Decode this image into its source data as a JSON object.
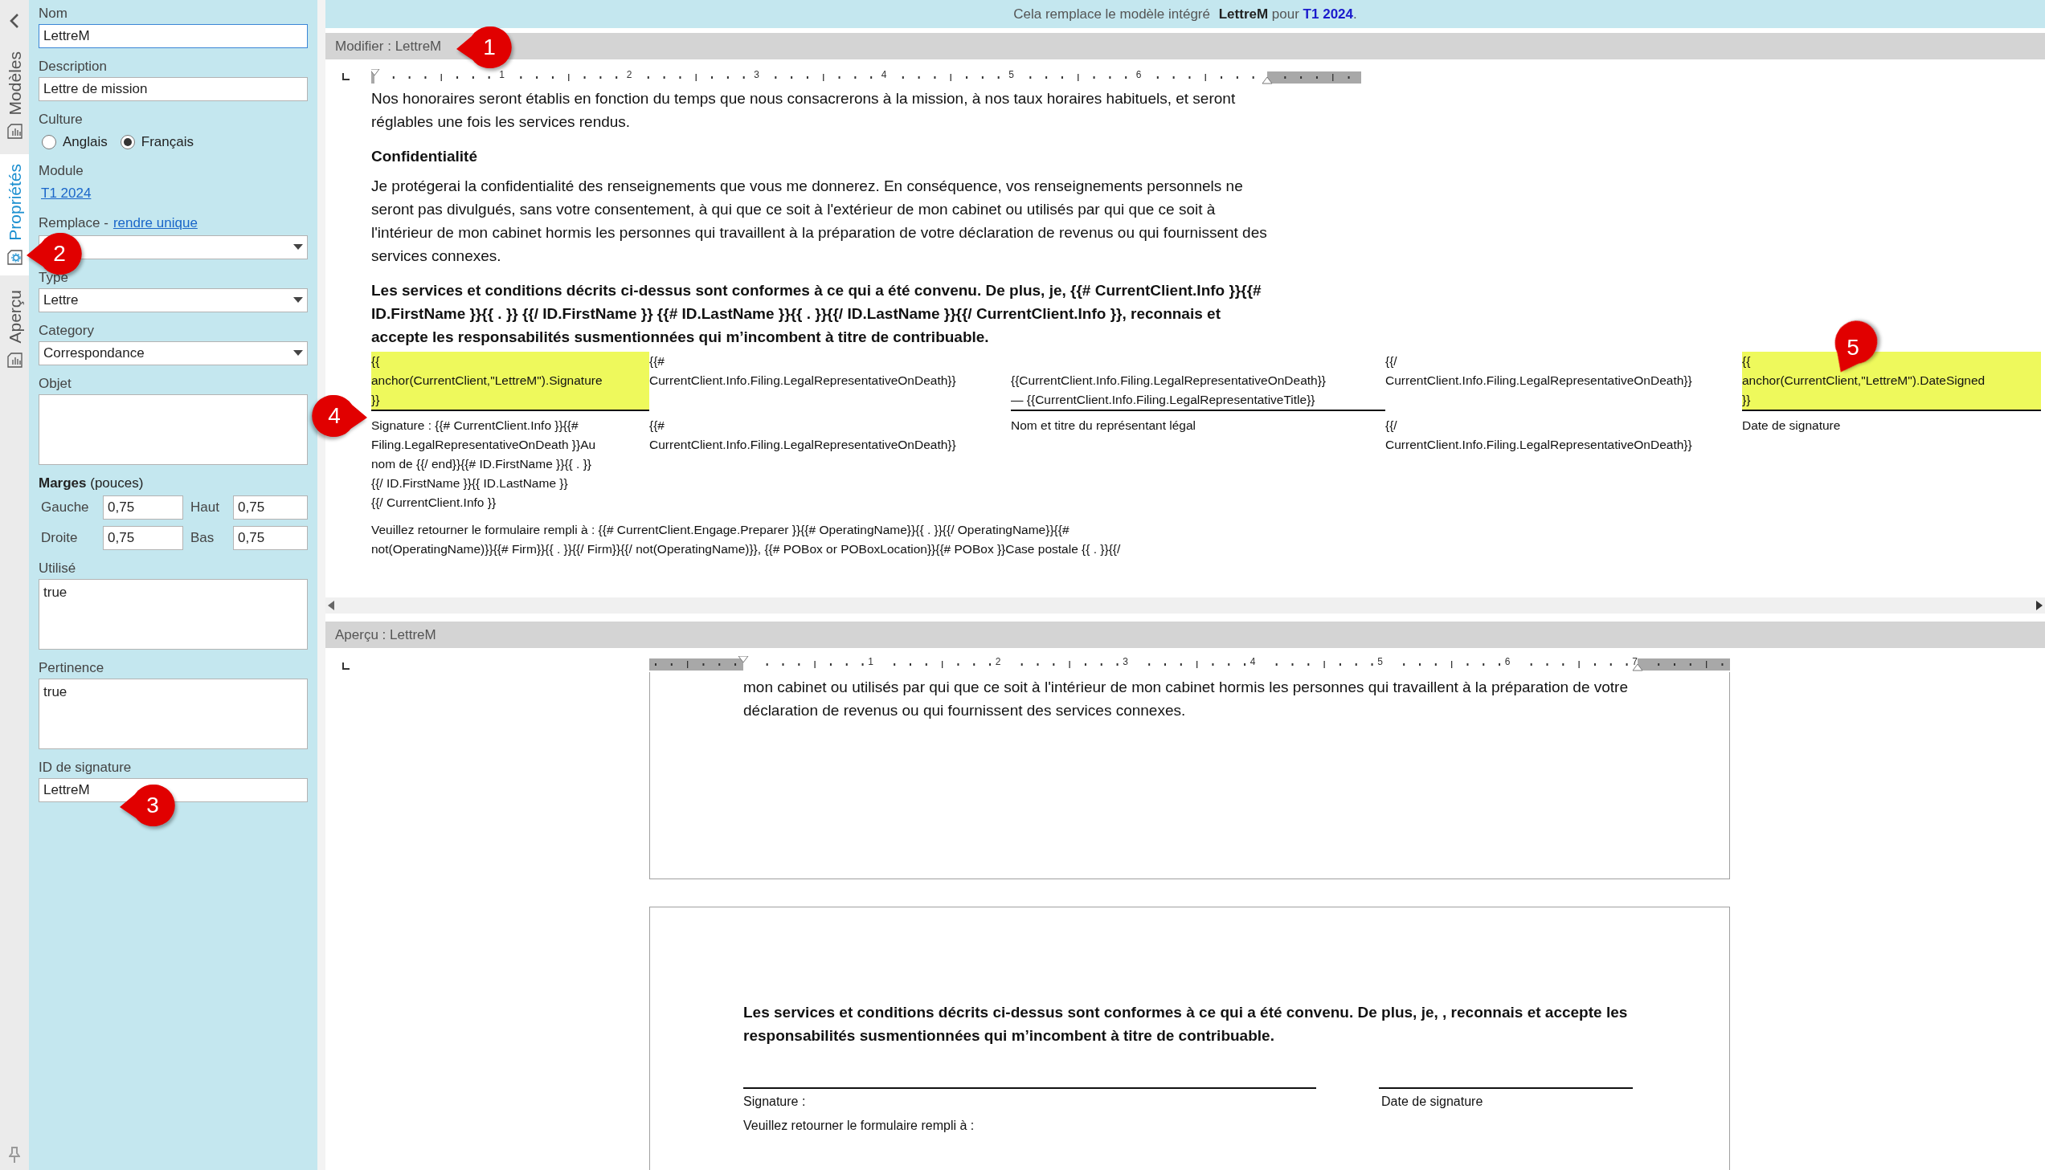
{
  "side_tabs": [
    {
      "label": "Modèles",
      "selected": false
    },
    {
      "label": "Propriétés",
      "selected": true
    },
    {
      "label": "Aperçu",
      "selected": false
    }
  ],
  "properties": {
    "fields": [
      {
        "kind": "text",
        "label": "Nom",
        "value": "LettreM",
        "focused": true
      },
      {
        "kind": "text",
        "label": "Description",
        "value": "Lettre de mission",
        "focused": false
      },
      {
        "kind": "radio",
        "label": "Culture",
        "options": [
          {
            "label": "Anglais",
            "selected": false
          },
          {
            "label": "Français",
            "selected": true
          }
        ]
      },
      {
        "kind": "link",
        "label": "Module",
        "link": "T1 2024"
      },
      {
        "kind": "dropdown",
        "label": "Remplace -",
        "link": "rendre unique"
      },
      {
        "kind": "dropdown",
        "label": "Type",
        "value": "Lettre"
      },
      {
        "kind": "dropdown",
        "label": "Category",
        "value": "Correspondance"
      },
      {
        "kind": "textarea",
        "label": "Objet"
      },
      {
        "kind": "margins",
        "label": "**Marges** (pouces)",
        "items": [
          {
            "label": "Gauche",
            "value": "0,75"
          },
          {
            "label": "Haut",
            "value": "0,75"
          },
          {
            "label": "Droite",
            "value": "0,75"
          },
          {
            "label": "Bas",
            "value": "0,75"
          }
        ]
      },
      {
        "kind": "textarea",
        "label": "Utilisé",
        "value": "true"
      },
      {
        "kind": "textarea",
        "label": "Pertinence",
        "value": "true"
      },
      {
        "kind": "text",
        "label": "ID de signature",
        "value": "LettreM",
        "focused": false
      }
    ]
  },
  "banner": {
    "before": "Cela remplace le modèle intégré",
    "template": "LettreM",
    "middle": "pour",
    "module": "T1 2024",
    "after": "."
  },
  "editor": {
    "title": "Modifier : LettreM",
    "ruler": [
      "1",
      "2",
      "3",
      "4",
      "5",
      "6"
    ],
    "paragraphs": [
      {
        "kind": "normal",
        "text": "Nos honoraires seront établis en fonction du temps que nous consacrerons à la mission, à nos taux horaires habituels, et seront réglables une fois les services rendus."
      },
      {
        "kind": "heading",
        "text": "Confidentialité"
      },
      {
        "kind": "normal",
        "text": "Je protégerai la confidentialité des renseignements que vous me donnerez. En conséquence, vos renseignements personnels ne seront pas divulgués, sans votre consentement, à qui que ce soit à l'extérieur de mon cabinet ou utilisés par qui que ce soit à l'intérieur de mon cabinet hormis les personnes qui travaillent à la préparation de votre déclaration de revenus ou qui fournissent des services connexes."
      },
      {
        "kind": "bold",
        "text": "Les services et conditions décrits ci-dessus sont conformes à ce qui a été convenu. De plus, je, {{# CurrentClient.Info }}{{# ID.FirstName }}{{ . }} {{/ ID.FirstName }} {{# ID.LastName }}{{ . }}{{/ ID.LastName }}{{/ CurrentClient.Info }}, reconnais et accepte les responsabilités susmentionnées qui m’incombent à titre de contribuable."
      }
    ],
    "signature_table": [
      [
        {
          "lines": [
            "{{",
            "anchor(CurrentClient,\"LettreM\").Signature",
            "}}"
          ],
          "highlighted": true,
          "underlined": true
        },
        {
          "lines": [
            "{{#",
            "CurrentClient.Info.Filing.LegalRepresentativeOnDeath}}"
          ],
          "highlighted": false,
          "underlined": false
        },
        {
          "lines": [
            "{{CurrentClient.Info.Filing.LegalRepresentativeOnDeath}}",
            "— {{CurrentClient.Info.Filing.LegalRepresentativeTitle}}"
          ],
          "highlighted": false,
          "underlined": true
        },
        {
          "lines": [
            "{{/",
            "CurrentClient.Info.Filing.LegalRepresentativeOnDeath}}"
          ],
          "highlighted": false,
          "underlined": false
        },
        {
          "lines": [
            "{{",
            "anchor(CurrentClient,\"LettreM\").DateSigned",
            "}}"
          ],
          "highlighted": true,
          "underlined": true
        }
      ],
      [
        {
          "lines": [
            "Signature : {{# CurrentClient.Info }}{{#",
            "Filing.LegalRepresentativeOnDeath }}Au",
            "nom de {{/ end}}{{# ID.FirstName }}{{ . }}",
            "{{/ ID.FirstName }}{{ ID.LastName }}",
            "{{/ CurrentClient.Info }}"
          ],
          "highlighted": false,
          "underlined": false
        },
        {
          "lines": [
            "{{#",
            "CurrentClient.Info.Filing.LegalRepresentativeOnDeath}}"
          ],
          "highlighted": false,
          "underlined": false
        },
        {
          "lines": [
            "Nom et titre du représentant légal"
          ],
          "highlighted": false,
          "underlined": false
        },
        {
          "lines": [
            "{{/",
            "CurrentClient.Info.Filing.LegalRepresentativeOnDeath}}"
          ],
          "highlighted": false,
          "underlined": false
        },
        {
          "lines": [
            "Date de signature"
          ],
          "highlighted": false,
          "underlined": false
        }
      ]
    ],
    "closing_lines": [
      "Veuillez retourner le formulaire rempli à : {{# CurrentClient.Engage.Preparer }}{{# OperatingName}}{{ . }}{{/ OperatingName}}{{#",
      "not(OperatingName)}}{{# Firm}}{{ . }}{{/ Firm}}{{/ not(OperatingName)}}, {{# POBox or POBoxLocation}}{{# POBox }}Case postale {{ . }}{{/"
    ]
  },
  "preview": {
    "title": "Aperçu : LettreM",
    "ruler": [
      "1",
      "2",
      "3",
      "4",
      "5",
      "6",
      "7"
    ],
    "page1_text": "mon cabinet ou utilisés par qui que ce soit à l'intérieur de mon cabinet hormis les personnes qui travaillent à la préparation de votre déclaration de revenus ou qui fournissent des services connexes.",
    "page2_text": "Les services et conditions décrits ci-dessus sont conformes à ce qui a été convenu. De plus, je, , reconnais et accepte les responsabilités susmentionnées qui m’incombent à titre de contribuable.",
    "signature_label": "Signature :",
    "date_label": "Date de signature",
    "return_text": "Veuillez retourner le formulaire rempli à :"
  },
  "callouts": [
    "1",
    "2",
    "3",
    "4",
    "5"
  ]
}
